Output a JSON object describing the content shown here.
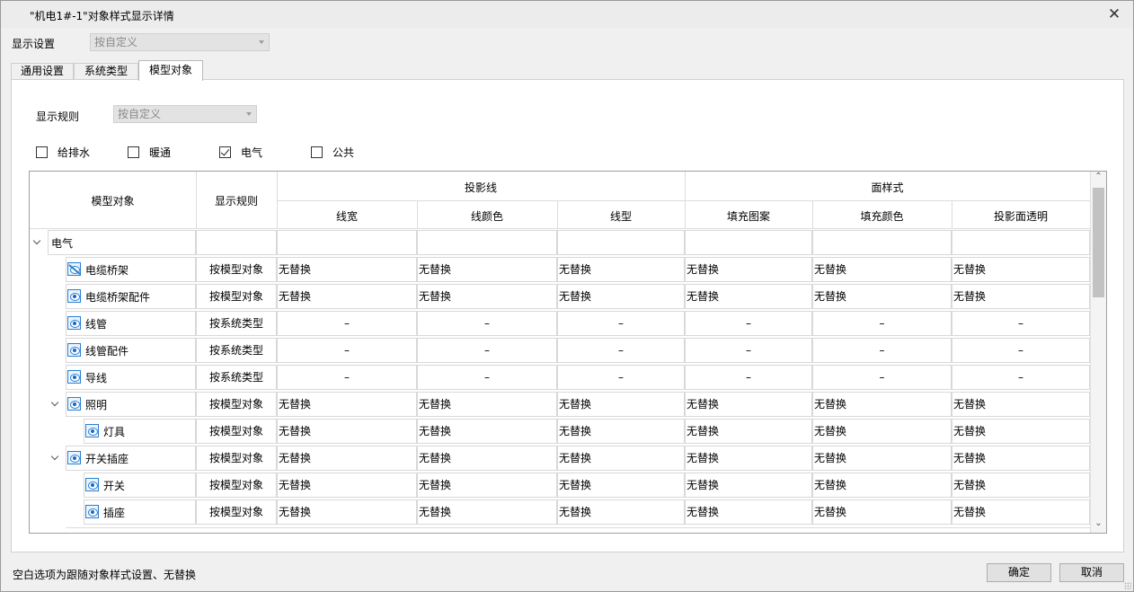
{
  "window": {
    "title": "\"机电1#-1\"对象样式显示详情",
    "close_icon": "close-icon"
  },
  "display_settings": {
    "label": "显示设置",
    "value": "按自定义"
  },
  "tabs": [
    {
      "label": "通用设置",
      "active": false
    },
    {
      "label": "系统类型",
      "active": false
    },
    {
      "label": "模型对象",
      "active": true
    }
  ],
  "display_rule": {
    "label": "显示规则",
    "value": "按自定义"
  },
  "filters": [
    {
      "label": "给排水",
      "checked": false
    },
    {
      "label": "暖通",
      "checked": false
    },
    {
      "label": "电气",
      "checked": true
    },
    {
      "label": "公共",
      "checked": false
    }
  ],
  "table": {
    "headers": {
      "model_object": "模型对象",
      "display_rule": "显示规则",
      "projection_group": "投影线",
      "surface_group": "面样式",
      "line_width": "线宽",
      "line_color": "线颜色",
      "line_type": "线型",
      "fill_pattern": "填充图案",
      "fill_color": "填充颜色",
      "surface_transparency": "投影面透明"
    },
    "rows": [
      {
        "name": "电气",
        "level": 0,
        "expandable": true,
        "icon": "",
        "rule": "",
        "values": [
          "",
          "",
          "",
          "",
          "",
          ""
        ]
      },
      {
        "name": "电缆桥架",
        "level": 1,
        "expandable": false,
        "icon": "eye-hidden-icon",
        "rule": "按模型对象",
        "values": [
          "无替换",
          "无替换",
          "无替换",
          "无替换",
          "无替换",
          "无替换"
        ]
      },
      {
        "name": "电缆桥架配件",
        "level": 1,
        "expandable": false,
        "icon": "eye-icon",
        "rule": "按模型对象",
        "values": [
          "无替换",
          "无替换",
          "无替换",
          "无替换",
          "无替换",
          "无替换"
        ]
      },
      {
        "name": "线管",
        "level": 1,
        "expandable": false,
        "icon": "eye-icon",
        "rule": "按系统类型",
        "values": [
          "–",
          "–",
          "–",
          "–",
          "–",
          "–"
        ]
      },
      {
        "name": "线管配件",
        "level": 1,
        "expandable": false,
        "icon": "eye-icon",
        "rule": "按系统类型",
        "values": [
          "–",
          "–",
          "–",
          "–",
          "–",
          "–"
        ]
      },
      {
        "name": "导线",
        "level": 1,
        "expandable": false,
        "icon": "eye-icon",
        "rule": "按系统类型",
        "values": [
          "–",
          "–",
          "–",
          "–",
          "–",
          "–"
        ]
      },
      {
        "name": "照明",
        "level": 1,
        "expandable": true,
        "icon": "eye-icon",
        "rule": "按模型对象",
        "values": [
          "无替换",
          "无替换",
          "无替换",
          "无替换",
          "无替换",
          "无替换"
        ]
      },
      {
        "name": "灯具",
        "level": 2,
        "expandable": false,
        "icon": "eye-icon",
        "rule": "按模型对象",
        "values": [
          "无替换",
          "无替换",
          "无替换",
          "无替换",
          "无替换",
          "无替换"
        ]
      },
      {
        "name": "开关插座",
        "level": 1,
        "expandable": true,
        "icon": "eye-icon",
        "rule": "按模型对象",
        "values": [
          "无替换",
          "无替换",
          "无替换",
          "无替换",
          "无替换",
          "无替换"
        ]
      },
      {
        "name": "开关",
        "level": 2,
        "expandable": false,
        "icon": "eye-icon",
        "rule": "按模型对象",
        "values": [
          "无替换",
          "无替换",
          "无替换",
          "无替换",
          "无替换",
          "无替换"
        ]
      },
      {
        "name": "插座",
        "level": 2,
        "expandable": false,
        "icon": "eye-icon",
        "rule": "按模型对象",
        "values": [
          "无替换",
          "无替换",
          "无替换",
          "无替换",
          "无替换",
          "无替换"
        ]
      }
    ]
  },
  "footer": {
    "hint": "空白选项为跟随对象样式设置、无替换",
    "ok_label": "确定",
    "cancel_label": "取消"
  },
  "colors": {
    "accent": "#2a7fd2",
    "border": "#a0a0a0"
  }
}
